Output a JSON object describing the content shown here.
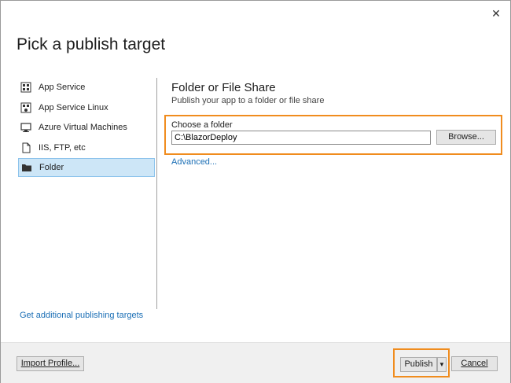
{
  "dialog": {
    "close_glyph": "✕",
    "title": "Pick a publish target"
  },
  "sidebar": {
    "items": [
      {
        "label": "App Service",
        "icon": "app-service-icon",
        "selected": false
      },
      {
        "label": "App Service Linux",
        "icon": "app-service-linux-icon",
        "selected": false
      },
      {
        "label": "Azure Virtual Machines",
        "icon": "virtual-machines-icon",
        "selected": false
      },
      {
        "label": "IIS, FTP, etc",
        "icon": "file-icon",
        "selected": false
      },
      {
        "label": "Folder",
        "icon": "folder-icon",
        "selected": true
      }
    ],
    "more_link": "Get additional publishing targets"
  },
  "content": {
    "heading": "Folder or File Share",
    "subheading": "Publish your app to a folder or file share",
    "folder_label": "Choose a folder",
    "folder_value": "C:\\BlazorDeploy",
    "browse_label": "Browse...",
    "advanced_link": "Advanced..."
  },
  "footer": {
    "import_label": "Import Profile...",
    "publish_label": "Publish",
    "publish_arrow": "▼",
    "cancel_label": "Cancel"
  },
  "colors": {
    "accent_highlight": "#f08c1e",
    "link": "#1a6eb5",
    "selected_bg": "#cde6f7"
  }
}
